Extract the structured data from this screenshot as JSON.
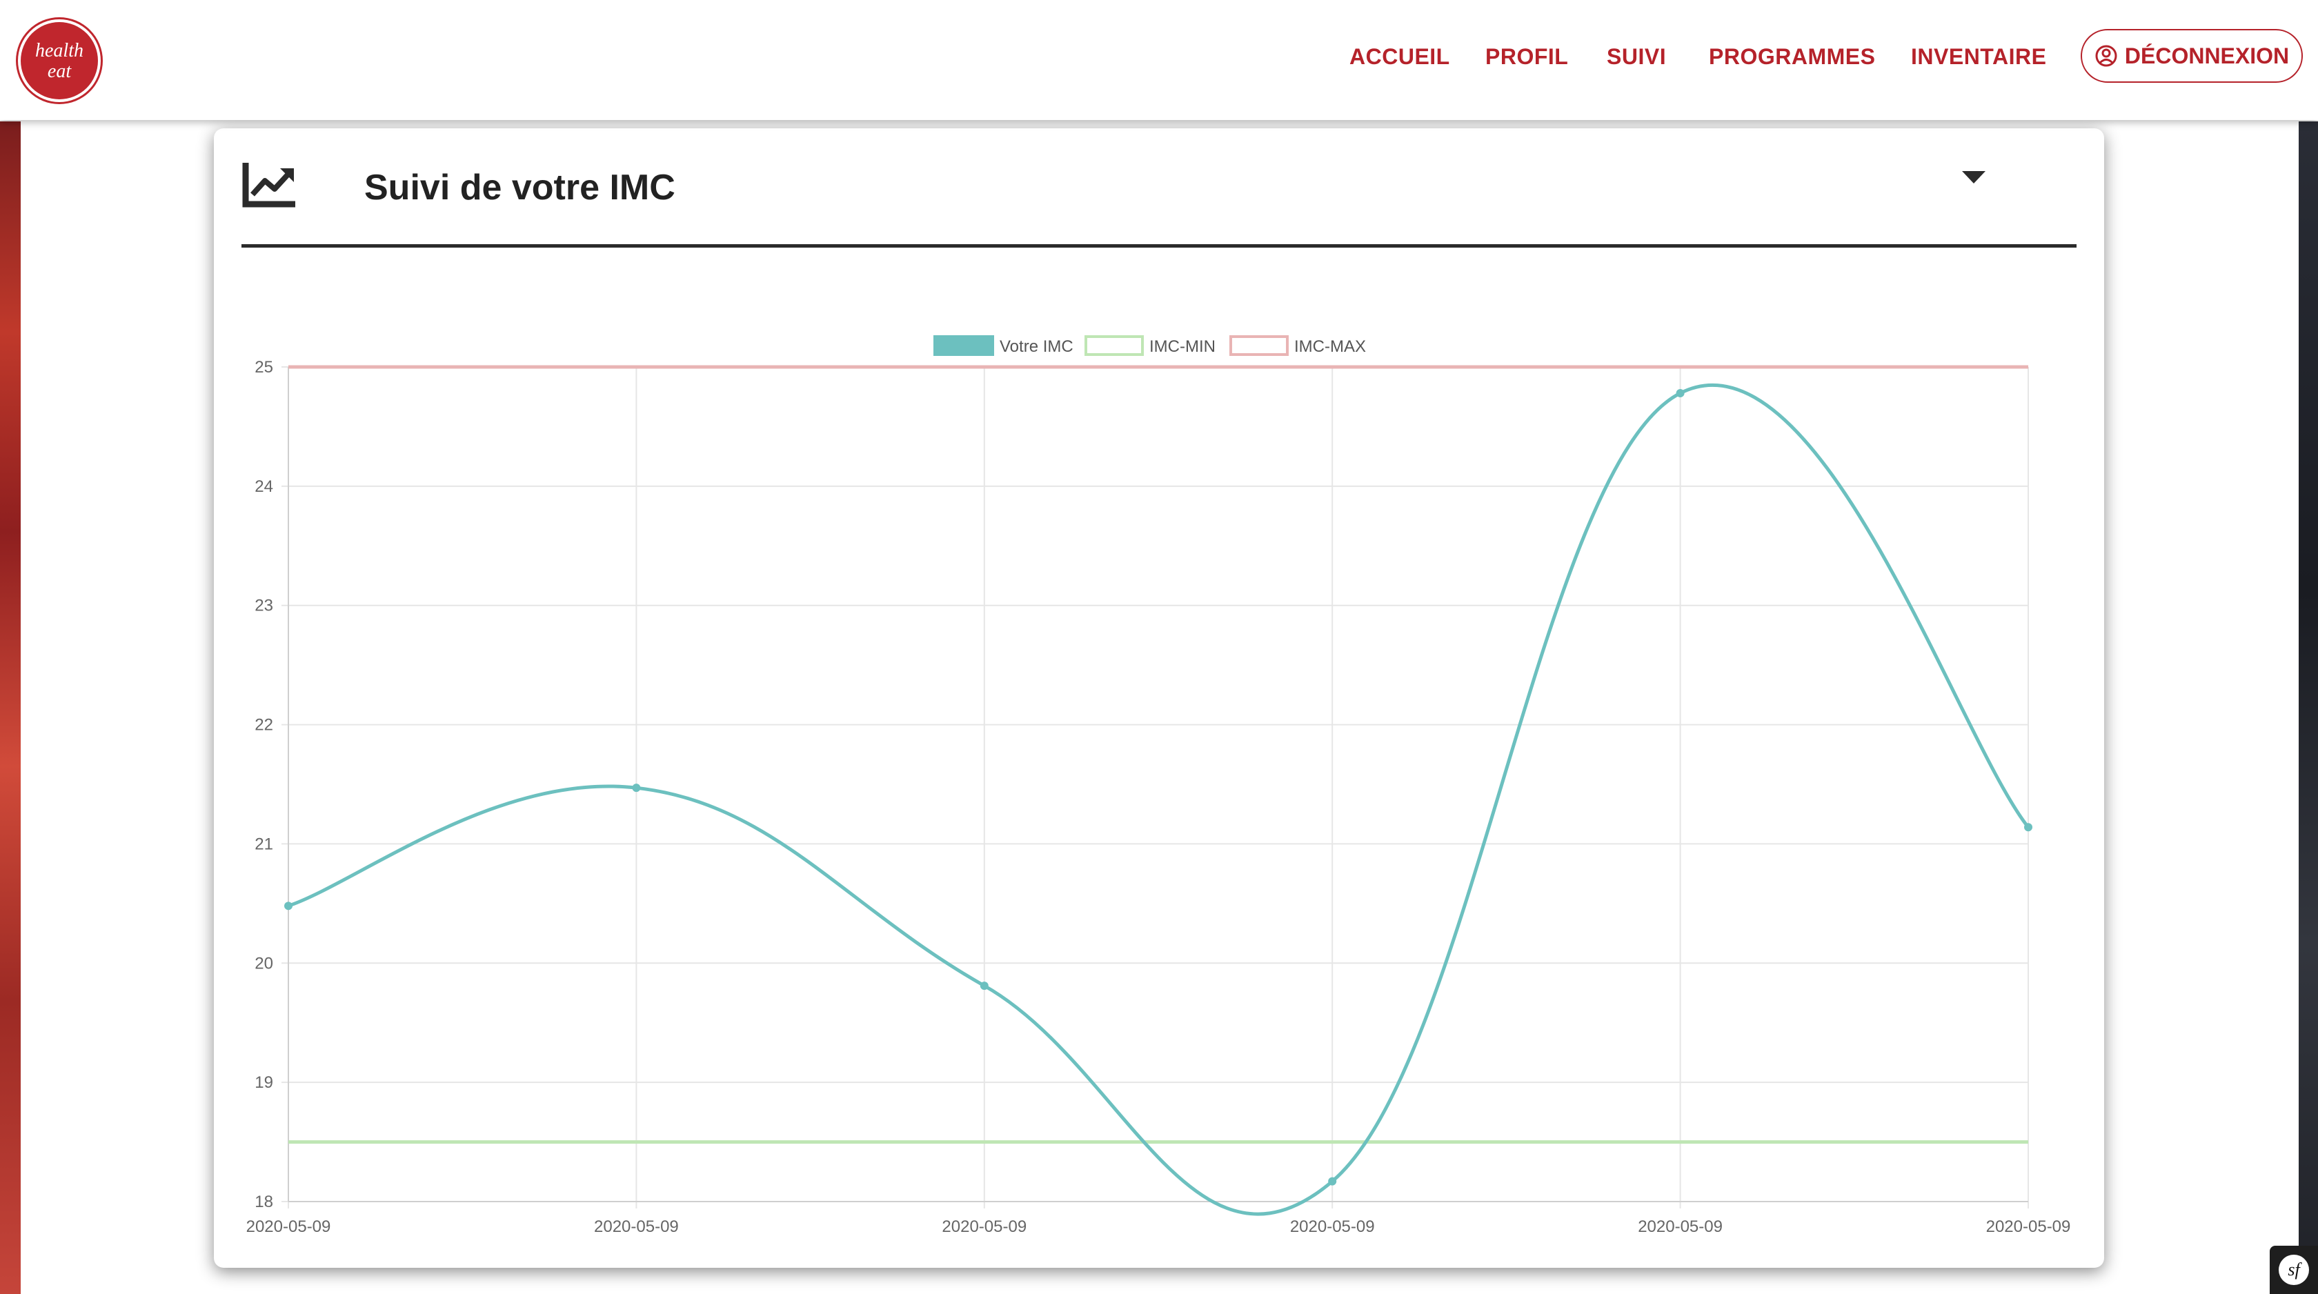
{
  "nav": {
    "logo_line1": "health",
    "logo_line2": "eat",
    "items": [
      "ACCUEIL",
      "PROFIL",
      "SUIVI",
      "PROGRAMMES",
      "INVENTAIRE"
    ],
    "logout_label": "DÉCONNEXION"
  },
  "card": {
    "title": "Suivi de votre IMC"
  },
  "colors": {
    "brand": "#b5222a",
    "imc": "#6cc0bf",
    "imc_min": "#bfe6b4",
    "imc_max": "#e9b4b4"
  },
  "chart_data": {
    "type": "line",
    "x": [
      "2020-05-09",
      "2020-05-09",
      "2020-05-09",
      "2020-05-09",
      "2020-05-09",
      "2020-05-09"
    ],
    "series": [
      {
        "name": "Votre IMC",
        "values": [
          20.48,
          21.47,
          19.81,
          18.17,
          24.78,
          21.14
        ]
      },
      {
        "name": "IMC-MIN",
        "values": [
          18.5,
          18.5,
          18.5,
          18.5,
          18.5,
          18.5
        ]
      },
      {
        "name": "IMC-MAX",
        "values": [
          25,
          25,
          25,
          25,
          25,
          25
        ]
      }
    ],
    "ylim": [
      18,
      25
    ],
    "yticks": [
      18,
      19,
      20,
      21,
      22,
      23,
      24,
      25
    ],
    "grid": true,
    "legend": "top-center"
  },
  "symfony_badge": "sf"
}
